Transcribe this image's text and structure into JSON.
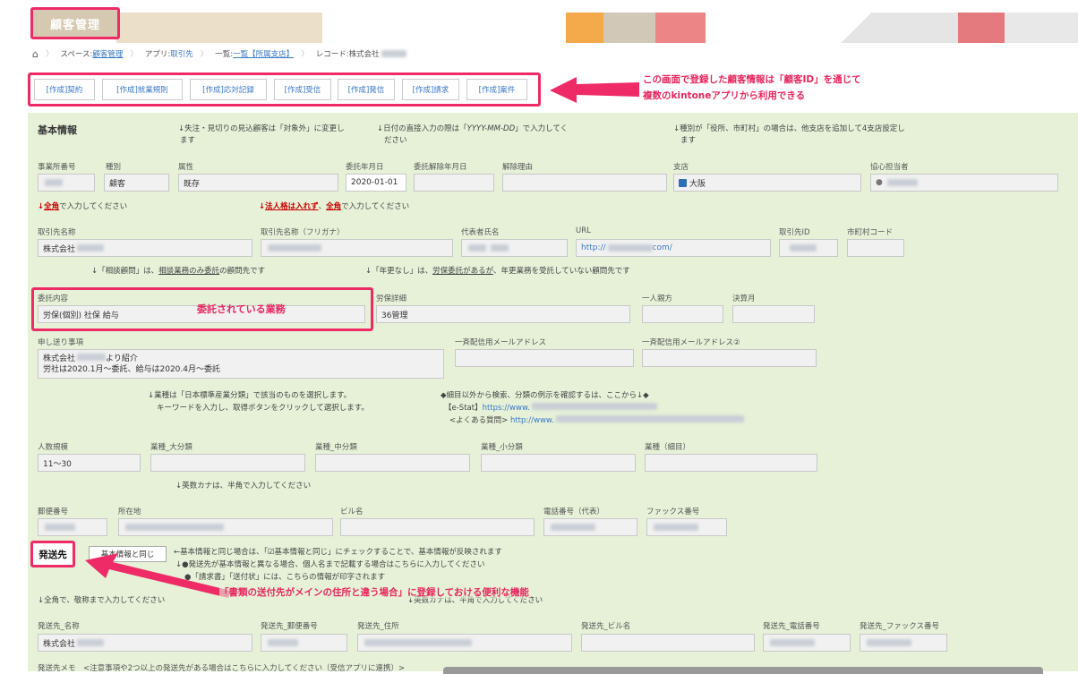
{
  "app": {
    "title": "顧客管理"
  },
  "breadcrumb": {
    "space_prefix": "スペース:",
    "space": "顧客管理",
    "app_prefix": "アプリ:",
    "app": "取引先",
    "list_prefix": "一覧:",
    "list": "一覧【所属支店】",
    "record_prefix": "レコード:",
    "record": "株式会社"
  },
  "toolbar": [
    "[作成]契約",
    "[作成]就業規則",
    "[作成]応対記録",
    "[作成]受信",
    "[作成]発信",
    "[作成]請求",
    "[作成]案件"
  ],
  "annotation_top": {
    "line1": "この画面で登録した顧客情報は「顧客ID」を通じて",
    "line2": "複数のkintoneアプリから利用できる"
  },
  "annotation_mid": "委託されている業務",
  "annotation_bottom": "「書類の送付先がメインの住所と違う場合」に登録しておける便利な機能",
  "basic": {
    "title": "基本情報",
    "note1a": "↓失注・見切りの見込顧客は「対象外」に変更し",
    "note1b": "ます",
    "note2a": "↓日付の直接入力の際は「",
    "note2i": "YYYY-MM-DD",
    "note2c": "」で入力してく",
    "note2b": "ださい",
    "note3a": "↓種別が「役所、市町村」の場合は、他支店を追加して4支店設定し",
    "note3b": "ます"
  },
  "row1": {
    "labels": [
      "事業所番号",
      "種別",
      "属性",
      "委託年月日",
      "委託解除年月日",
      "解除理由",
      "支店",
      "協心担当者"
    ],
    "kind": "顧客",
    "attr": "既存",
    "date": "2020-01-01",
    "branch": "大阪"
  },
  "note_zen1": {
    "arrow": "↓",
    "red": "全角",
    "rest": "で入力してください"
  },
  "note_zen2": {
    "arrow": "↓",
    "red": "法人格は入れず",
    "sep": "、",
    "red2": "全角",
    "rest": "で入力してください"
  },
  "row2": {
    "labels": [
      "取引先名称",
      "取引先名称（フリガナ）",
      "代表者氏名",
      "URL",
      "取引先ID",
      "市町村コード"
    ],
    "name": "株式会社",
    "url_a": "http://",
    "url_b": "com/"
  },
  "note_sodan": {
    "a": "↓「相談顧問」は、",
    "b": "相談業務のみ委託",
    "c": "の顧問先です"
  },
  "note_nenkou": {
    "a": "↓「年更なし」は、",
    "b": "労保委託があるが",
    "c": "、年更業務を受託していない顧問先です"
  },
  "row3": {
    "labels": [
      "委託内容",
      "労保詳細",
      "一人親方",
      "決算月"
    ],
    "itaku": "労保(個別) 社保 給与",
    "rouho": "36管理"
  },
  "row4": {
    "labels": [
      "申し送り事項",
      "一斉配信用メールアドレス",
      "一斉配信用メールアドレス②"
    ],
    "line1a": "株式会社",
    "line1b": "より紹介",
    "line2": "労社は2020.1月～委託、給与は2020.4月～委託"
  },
  "industry_note": {
    "l1": "↓業種は「日本標準産業分類」で該当のものを選択します。",
    "l2": "キーワードを入力し、取得ボタンをクリックして選択します。",
    "r1": "◆細目以外から検索、分類の例示を確認するは、ここから↓◆",
    "r2a": "【e-Stat】",
    "r2b": "https://www.",
    "r3a": "<よくある質問>",
    "r3b": "http://www."
  },
  "row5": {
    "labels": [
      "人数規模",
      "業種_大分類",
      "業種_中分類",
      "業種_小分類",
      "業種（細目）"
    ],
    "size": "11～30"
  },
  "note_kana": "↓英数カナは、半角で入力してください",
  "row6": {
    "labels": [
      "郵便番号",
      "所在地",
      "ビル名",
      "電話番号（代表）",
      "ファックス番号"
    ]
  },
  "shipping": {
    "title": "発送先",
    "same_button": "基本情報と同じ",
    "n1": "←基本情報と同じ場合は、「☑基本情報と同じ」にチェックすることで、基本情報が反映されます",
    "n2": "↓●発送先が基本情報と異なる場合、個人名まで記載する場合はこちらに入力してください",
    "n3": "●「請求書」「送付状」には、こちらの情報が印字されます",
    "n4": "↓全角で、敬称まで入力してください",
    "n5": "↓英数カナは、半角で入力してください"
  },
  "row7": {
    "labels": [
      "発送先_名称",
      "発送先_郵便番号",
      "発送先_住所",
      "発送先_ビル名",
      "発送先_電話番号",
      "発送先_ファックス番号"
    ],
    "name": "株式会社"
  },
  "memo": "発送先メモ　<注意事項や2つ以上の発送先がある場合はこちらに入力してください（受信アプリに連携）>",
  "colors": {
    "accent": "#ee2b66",
    "form_bg": "#e6f1d8",
    "link": "#3a77c7"
  }
}
